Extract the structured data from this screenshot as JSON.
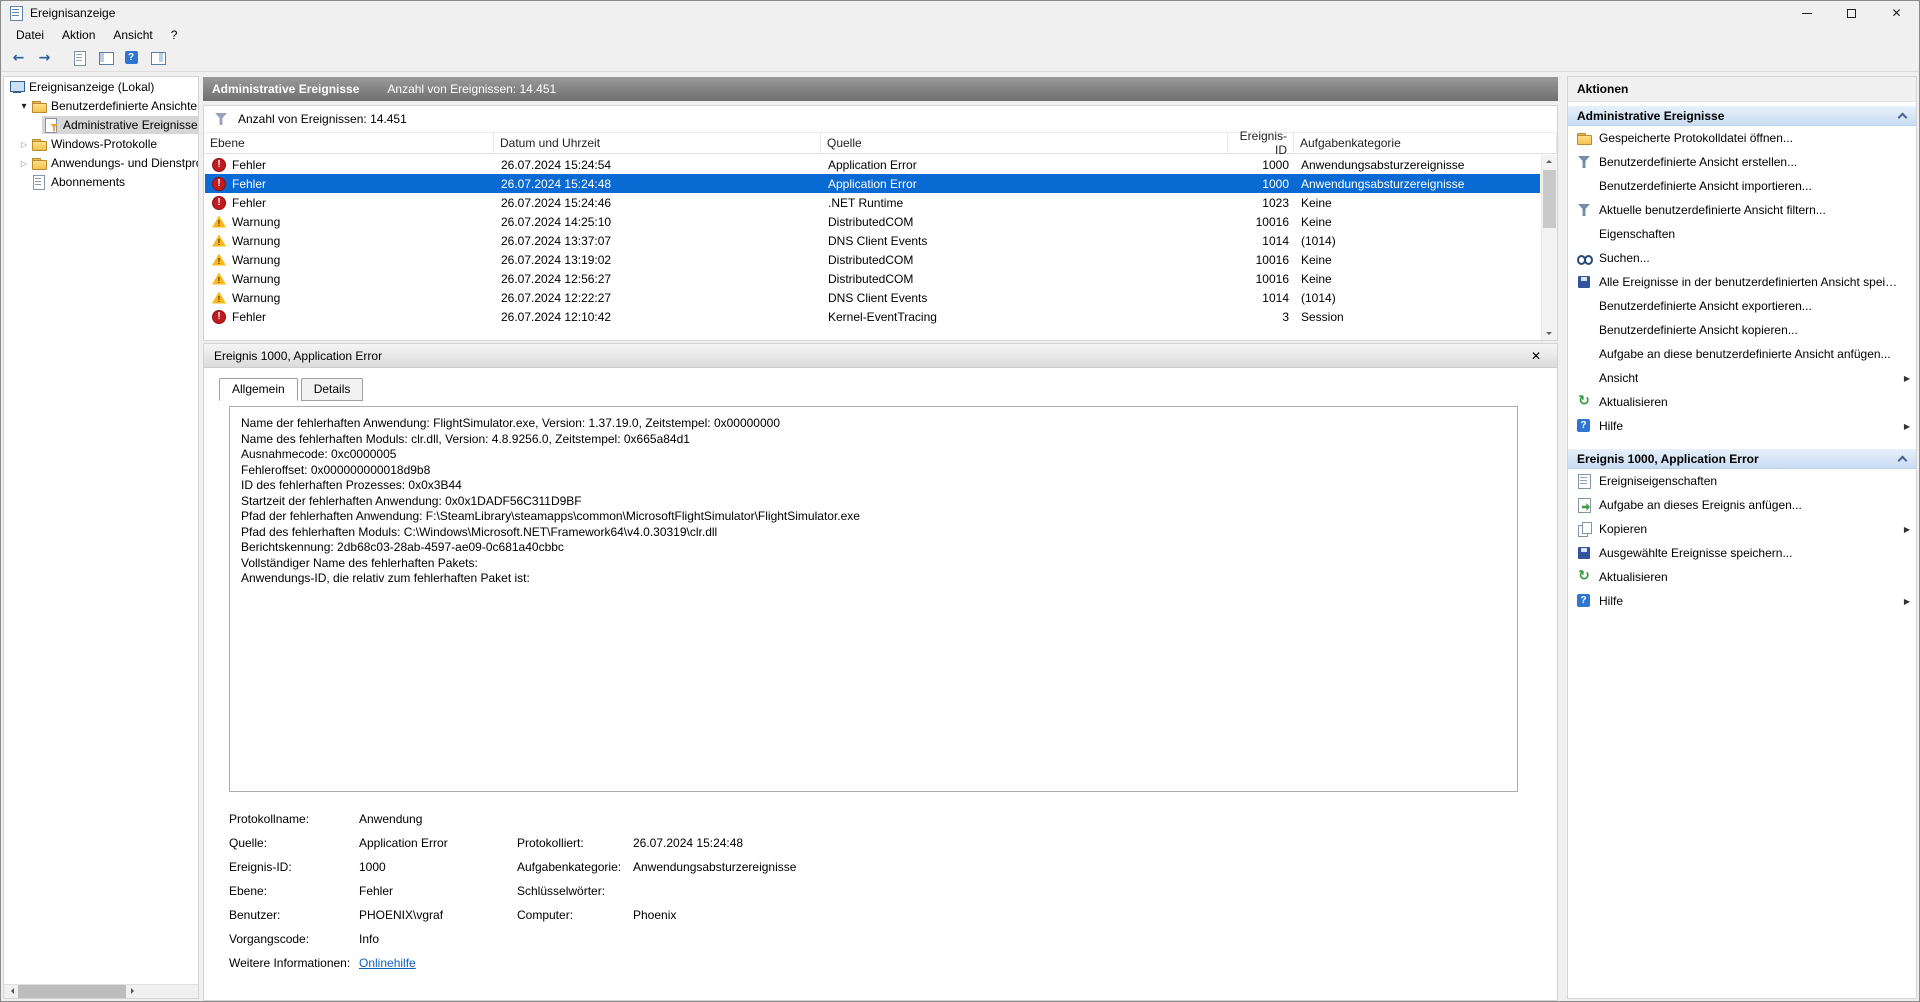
{
  "window": {
    "title": "Ereignisanzeige",
    "menu": [
      {
        "label": "Datei"
      },
      {
        "label": "Aktion"
      },
      {
        "label": "Ansicht"
      },
      {
        "label": "?"
      }
    ],
    "toolbar": [
      {
        "icon": "back"
      },
      {
        "icon": "forward"
      },
      {
        "icon": "open-saved-log"
      },
      {
        "icon": "toggle-console-tree"
      },
      {
        "icon": "help"
      },
      {
        "icon": "toggle-action-pane"
      }
    ]
  },
  "tree": {
    "root": "Ereignisanzeige (Lokal)",
    "items": [
      "Benutzerdefinierte Ansichten",
      "Administrative Ereignisse",
      "Windows-Protokolle",
      "Anwendungs- und Dienstprotokolle",
      "Abonnements"
    ]
  },
  "main": {
    "header": {
      "title": "Administrative Ereignisse",
      "count": "Anzahl von Ereignissen: 14.451"
    },
    "filter_label": "Anzahl von Ereignissen: 14.451",
    "columns": [
      "Ebene",
      "Datum und Uhrzeit",
      "Quelle",
      "Ereignis-ID",
      "Aufgabenkategorie"
    ],
    "rows": [
      {
        "type": "error",
        "level": "Fehler",
        "date": "26.07.2024 15:24:54",
        "source": "Application Error",
        "id": "1000",
        "category": "Anwendungsabsturzereignisse"
      },
      {
        "type": "error",
        "level": "Fehler",
        "date": "26.07.2024 15:24:48",
        "source": "Application Error",
        "id": "1000",
        "category": "Anwendungsabsturzereignisse",
        "selected": true
      },
      {
        "type": "error",
        "level": "Fehler",
        "date": "26.07.2024 15:24:46",
        "source": ".NET Runtime",
        "id": "1023",
        "category": "Keine"
      },
      {
        "type": "warning",
        "level": "Warnung",
        "date": "26.07.2024 14:25:10",
        "source": "DistributedCOM",
        "id": "10016",
        "category": "Keine"
      },
      {
        "type": "warning",
        "level": "Warnung",
        "date": "26.07.2024 13:37:07",
        "source": "DNS Client Events",
        "id": "1014",
        "category": "(1014)"
      },
      {
        "type": "warning",
        "level": "Warnung",
        "date": "26.07.2024 13:19:02",
        "source": "DistributedCOM",
        "id": "10016",
        "category": "Keine"
      },
      {
        "type": "warning",
        "level": "Warnung",
        "date": "26.07.2024 12:56:27",
        "source": "DistributedCOM",
        "id": "10016",
        "category": "Keine"
      },
      {
        "type": "warning",
        "level": "Warnung",
        "date": "26.07.2024 12:22:27",
        "source": "DNS Client Events",
        "id": "1014",
        "category": "(1014)"
      },
      {
        "type": "error",
        "level": "Fehler",
        "date": "26.07.2024 12:10:42",
        "source": "Kernel-EventTracing",
        "id": "3",
        "category": "Session"
      }
    ]
  },
  "detail": {
    "title": "Ereignis 1000, Application Error",
    "tabs": [
      "Allgemein",
      "Details"
    ],
    "lines": [
      "Name der fehlerhaften Anwendung: FlightSimulator.exe, Version: 1.37.19.0, Zeitstempel: 0x00000000",
      "Name des fehlerhaften Moduls: clr.dll, Version: 4.8.9256.0, Zeitstempel: 0x665a84d1",
      "Ausnahmecode: 0xc0000005",
      "Fehleroffset: 0x000000000018d9b8",
      "ID des fehlerhaften Prozesses: 0x0x3B44",
      "Startzeit der fehlerhaften Anwendung: 0x0x1DADF56C311D9BF",
      "Pfad der fehlerhaften Anwendung: F:\\SteamLibrary\\steamapps\\common\\MicrosoftFlightSimulator\\FlightSimulator.exe",
      "Pfad des fehlerhaften Moduls: C:\\Windows\\Microsoft.NET\\Framework64\\v4.0.30319\\clr.dll",
      "Berichtskennung: 2db68c03-28ab-4597-ae09-0c681a40cbbc",
      "Vollständiger Name des fehlerhaften Pakets:",
      "Anwendungs-ID, die relativ zum fehlerhaften Paket ist:"
    ],
    "fields": [
      {
        "l1": "Protokollname:",
        "v1": "Anwendung",
        "l2": "",
        "v2": ""
      },
      {
        "l1": "Quelle:",
        "v1": "Application Error",
        "l2": "Protokolliert:",
        "v2": "26.07.2024 15:24:48"
      },
      {
        "l1": "Ereignis-ID:",
        "v1": "1000",
        "l2": "Aufgabenkategorie:",
        "v2": "Anwendungsabsturzereignisse"
      },
      {
        "l1": "Ebene:",
        "v1": "Fehler",
        "l2": "Schlüsselwörter:",
        "v2": ""
      },
      {
        "l1": "Benutzer:",
        "v1": "PHOENIX\\vgraf",
        "l2": "Computer:",
        "v2": "Phoenix"
      },
      {
        "l1": "Vorgangscode:",
        "v1": "Info",
        "l2": "",
        "v2": ""
      },
      {
        "l1": "Weitere Informationen:",
        "v1": "Onlinehilfe",
        "l2": "",
        "v2": "",
        "link": true
      }
    ]
  },
  "actions": {
    "title": "Aktionen",
    "sections": [
      {
        "title": "Administrative Ereignisse",
        "items": [
          {
            "icon": "open-log",
            "label": "Gespeicherte Protokolldatei öffnen..."
          },
          {
            "icon": "create-view",
            "label": "Benutzerdefinierte Ansicht erstellen..."
          },
          {
            "icon": "",
            "label": "Benutzerdefinierte Ansicht importieren..."
          },
          {
            "icon": "filter",
            "label": "Aktuelle benutzerdefinierte Ansicht filtern..."
          },
          {
            "icon": "",
            "label": "Eigenschaften"
          },
          {
            "icon": "find",
            "label": "Suchen..."
          },
          {
            "icon": "save",
            "label": "Alle Ereignisse in der benutzerdefinierten Ansicht speic..."
          },
          {
            "icon": "",
            "label": "Benutzerdefinierte Ansicht exportieren..."
          },
          {
            "icon": "",
            "label": "Benutzerdefinierte Ansicht kopieren..."
          },
          {
            "icon": "",
            "label": "Aufgabe an diese benutzerdefinierte Ansicht anfügen..."
          },
          {
            "icon": "",
            "label": "Ansicht",
            "submenu": true
          },
          {
            "icon": "refresh",
            "label": "Aktualisieren"
          },
          {
            "icon": "help",
            "label": "Hilfe",
            "submenu": true
          }
        ]
      },
      {
        "title": "Ereignis 1000, Application Error",
        "items": [
          {
            "icon": "properties",
            "label": "Ereigniseigenschaften"
          },
          {
            "icon": "attach-task",
            "label": "Aufgabe an dieses Ereignis anfügen..."
          },
          {
            "icon": "copy",
            "label": "Kopieren",
            "submenu": true
          },
          {
            "icon": "save",
            "label": "Ausgewählte Ereignisse speichern..."
          },
          {
            "icon": "refresh",
            "label": "Aktualisieren"
          },
          {
            "icon": "help",
            "label": "Hilfe",
            "submenu": true
          }
        ]
      }
    ]
  },
  "colors": {
    "selection": "#0a6ad4",
    "error": "#c01b1e",
    "warning": "#fcb817",
    "header_bar": "#7d7d7d",
    "section_header": "#c8dcf2",
    "link": "#0b5fbc"
  }
}
